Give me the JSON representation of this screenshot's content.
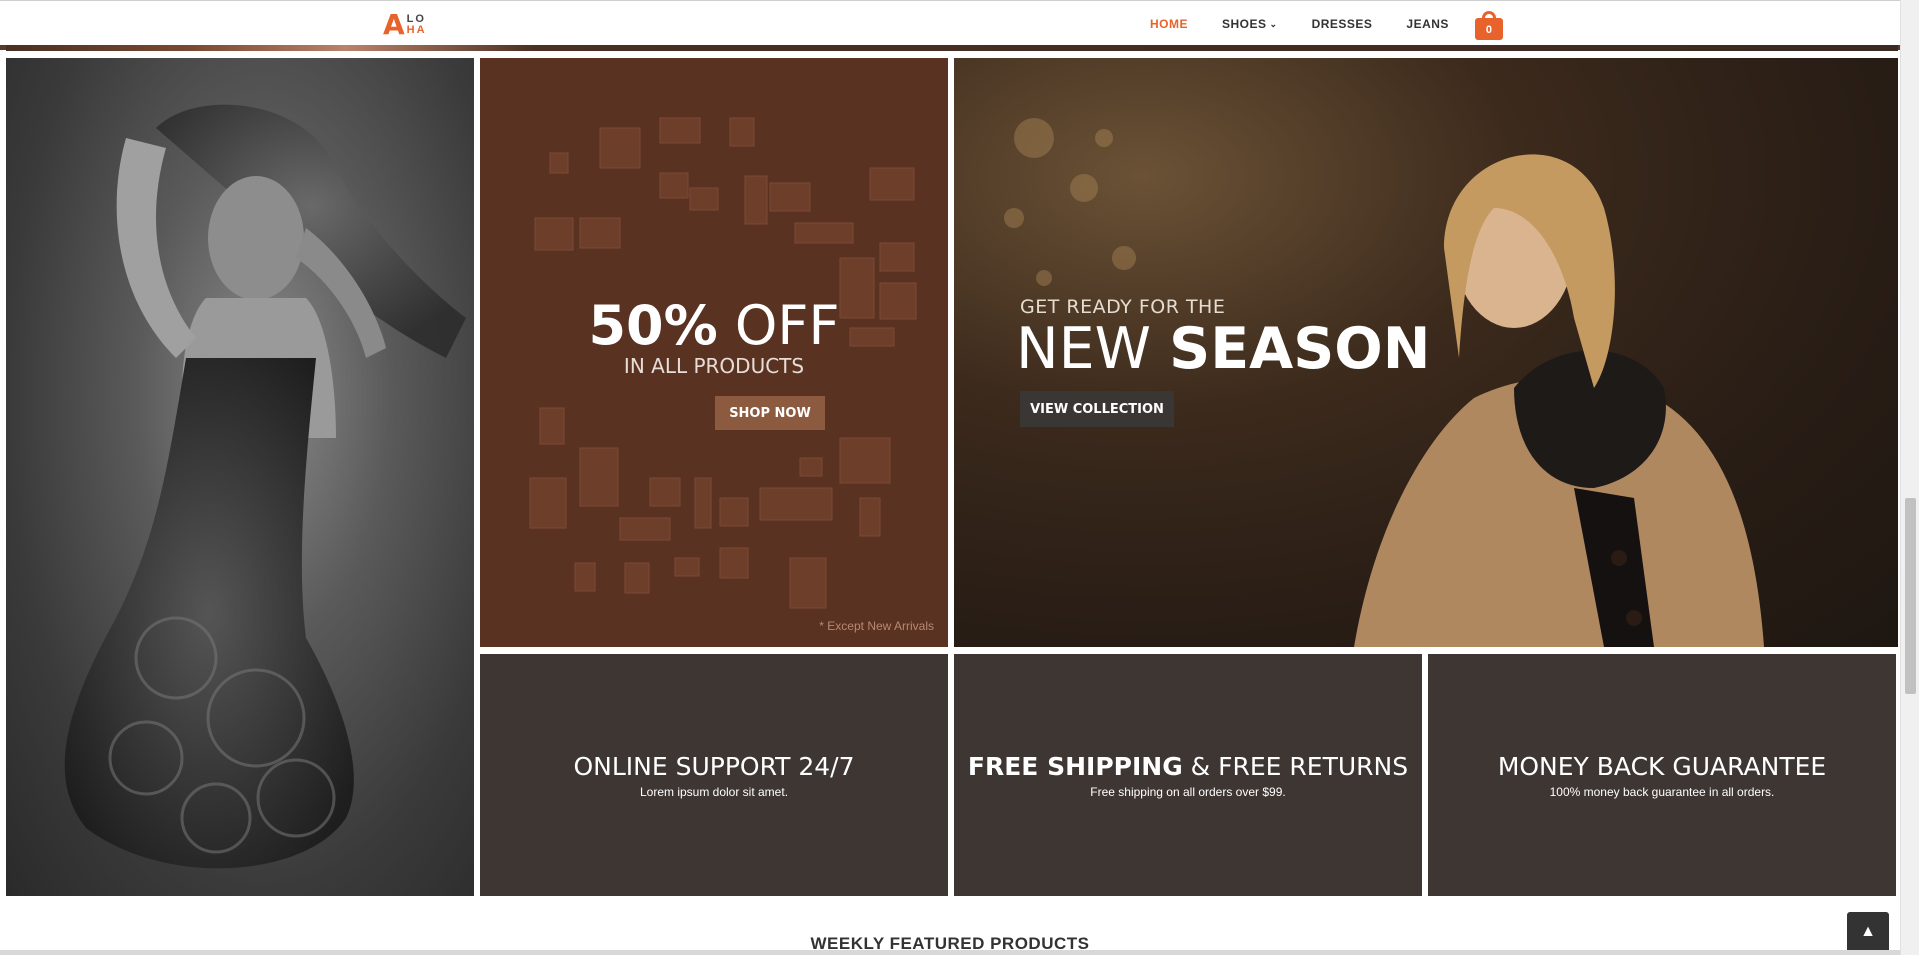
{
  "header": {
    "logo": {
      "letter": "A",
      "row1": "LO",
      "row2": "HA"
    },
    "nav": [
      {
        "label": "HOME",
        "active": true
      },
      {
        "label": "SHOES",
        "has_dropdown": true
      },
      {
        "label": "DRESSES"
      },
      {
        "label": "JEANS"
      }
    ],
    "cart_count": "0"
  },
  "promo_sale": {
    "title_bold": "50%",
    "title_light": "OFF",
    "subtitle": "IN ALL PRODUCTS",
    "button": "SHOP NOW",
    "note": "* Except New Arrivals"
  },
  "promo_season": {
    "pre": "GET READY FOR THE",
    "title_light": "NEW",
    "title_bold": "SEASON",
    "button": "VIEW COLLECTION"
  },
  "info_tiles": [
    {
      "title": "ONLINE SUPPORT 24/7",
      "sub": "Lorem ipsum dolor sit amet."
    },
    {
      "title_bold": "FREE SHIPPING",
      "title_rest": "& FREE RETURNS",
      "sub": "Free shipping on all orders over $99."
    },
    {
      "title": "MONEY BACK GUARANTEE",
      "sub": "100% money back guarantee in all orders."
    }
  ],
  "featured_title": "WEEKLY FEATURED PRODUCTS",
  "colors": {
    "accent": "#e8632b",
    "sale_bg": "#5a3222",
    "info_bg": "#3e3633"
  },
  "icons": {
    "cart": "shopping-bag-icon",
    "to_top": "chevron-up-icon"
  }
}
